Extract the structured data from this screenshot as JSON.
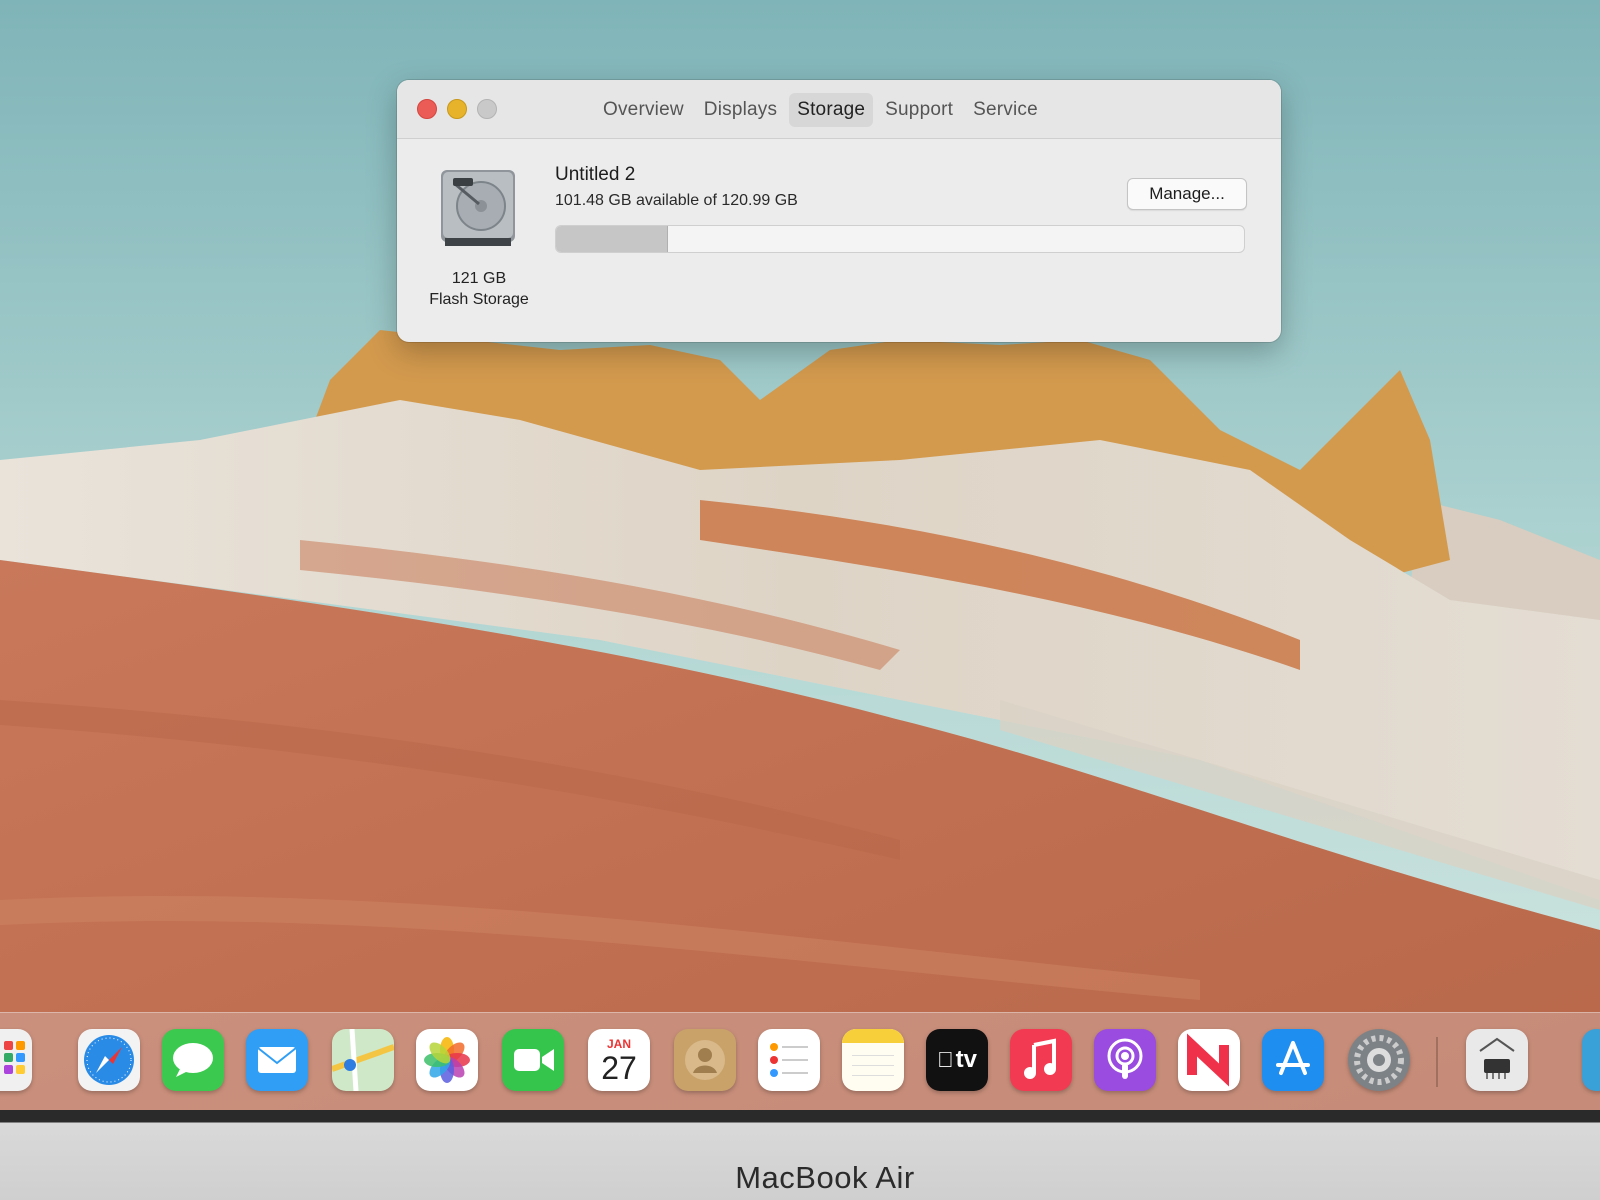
{
  "window": {
    "tabs": [
      {
        "label": "Overview",
        "active": false
      },
      {
        "label": "Displays",
        "active": false
      },
      {
        "label": "Storage",
        "active": true
      },
      {
        "label": "Support",
        "active": false
      },
      {
        "label": "Service",
        "active": false
      }
    ],
    "disk": {
      "size": "121 GB",
      "kind": "Flash Storage",
      "icon": "hard-drive-icon"
    },
    "volume": {
      "name": "Untitled 2",
      "available_text": "101.48 GB available of 120.99 GB",
      "available_gb": 101.48,
      "total_gb": 120.99
    },
    "manage_label": "Manage..."
  },
  "dock": {
    "apps": [
      {
        "name": "launchpad",
        "icon": "launchpad-icon"
      },
      {
        "name": "safari",
        "icon": "safari-icon"
      },
      {
        "name": "messages",
        "icon": "messages-icon"
      },
      {
        "name": "mail",
        "icon": "mail-icon"
      },
      {
        "name": "maps",
        "icon": "maps-icon"
      },
      {
        "name": "photos",
        "icon": "photos-icon"
      },
      {
        "name": "facetime",
        "icon": "facetime-icon"
      },
      {
        "name": "calendar",
        "icon": "calendar-icon",
        "month": "JAN",
        "day": "27"
      },
      {
        "name": "contacts",
        "icon": "contacts-icon"
      },
      {
        "name": "reminders",
        "icon": "reminders-icon"
      },
      {
        "name": "notes",
        "icon": "notes-icon"
      },
      {
        "name": "tv",
        "icon": "tv-icon",
        "label": "tv"
      },
      {
        "name": "music",
        "icon": "music-icon"
      },
      {
        "name": "podcasts",
        "icon": "podcasts-icon"
      },
      {
        "name": "news",
        "icon": "news-icon"
      },
      {
        "name": "app-store",
        "icon": "app-store-icon"
      },
      {
        "name": "system-preferences",
        "icon": "system-preferences-icon"
      },
      {
        "name": "system-information",
        "icon": "system-information-icon"
      }
    ]
  },
  "bezel": {
    "brand": "MacBook Air"
  },
  "colors": {
    "sky": "#9cc7c8",
    "sand": "#c87a55",
    "rock_white": "#e6e1d8",
    "rock_gold": "#d9a04a"
  }
}
